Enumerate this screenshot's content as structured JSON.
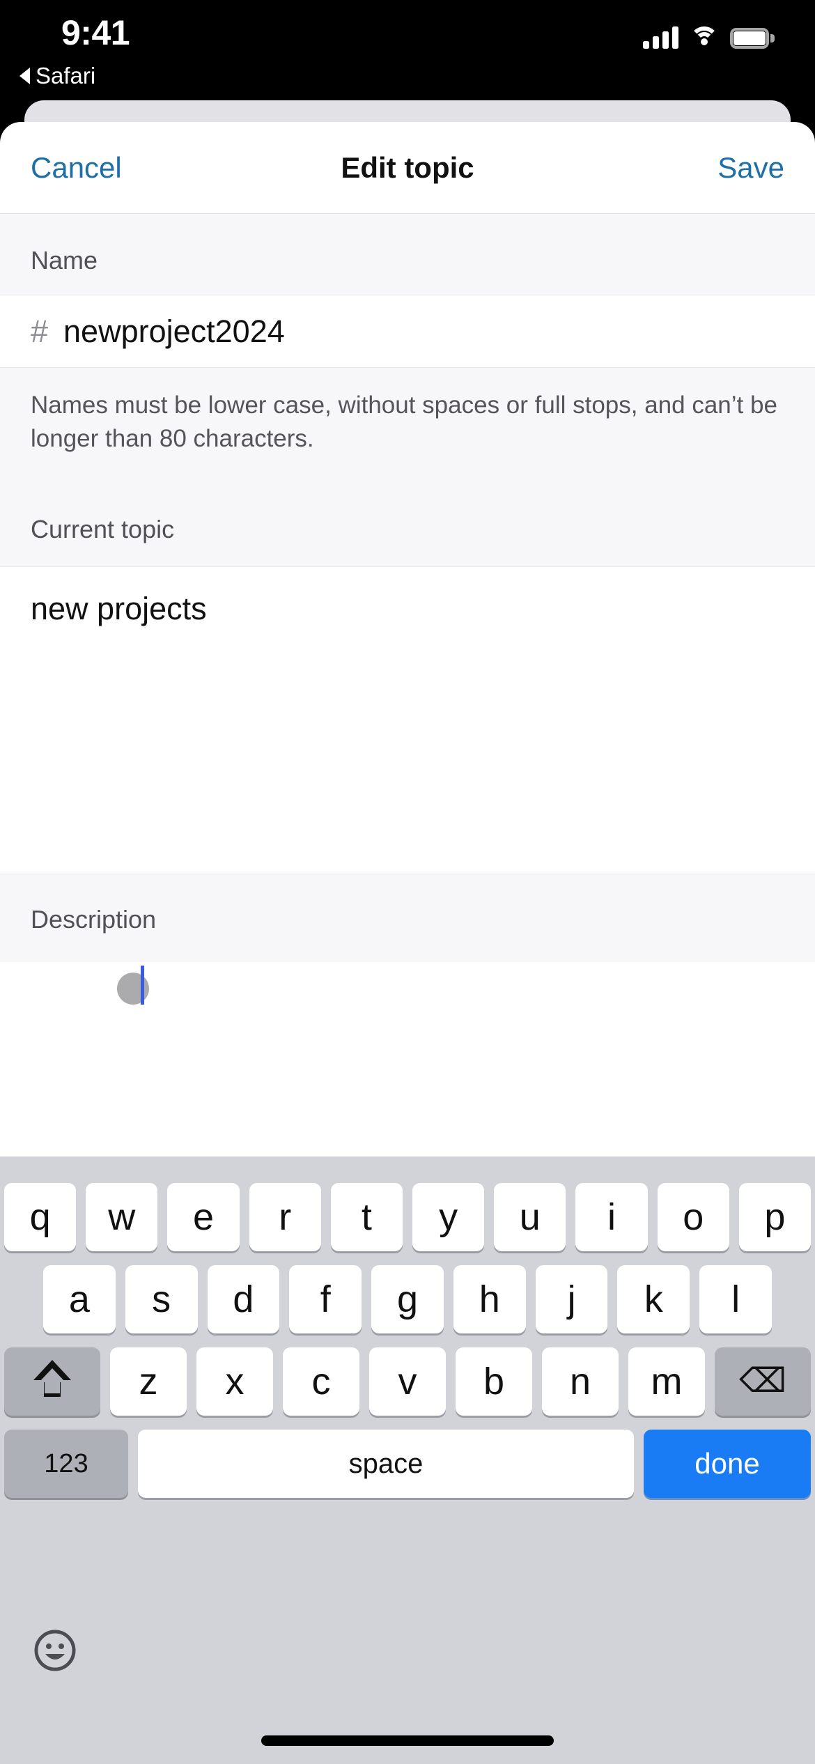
{
  "status_bar": {
    "time": "9:41",
    "back_app_label": "Safari",
    "icons": [
      "signal-bars-icon",
      "wifi-icon",
      "battery-icon"
    ]
  },
  "nav": {
    "cancel_label": "Cancel",
    "title": "Edit topic",
    "save_label": "Save",
    "accent_color": "#1d6fa5"
  },
  "form": {
    "name_section_label": "Name",
    "name_prefix": "#",
    "name_value": "newproject2024",
    "name_helper": "Names must be lower case, without spaces or full stops, and can’t be longer than 80 characters.",
    "topic_section_label": "Current topic",
    "topic_value": "new projects",
    "description_section_label": "Description"
  },
  "keyboard": {
    "row1": [
      "q",
      "w",
      "e",
      "r",
      "t",
      "y",
      "u",
      "i",
      "o",
      "p"
    ],
    "row2": [
      "a",
      "s",
      "d",
      "f",
      "g",
      "h",
      "j",
      "k",
      "l"
    ],
    "row3": [
      "z",
      "x",
      "c",
      "v",
      "b",
      "n",
      "m"
    ],
    "shift_key": "shift-icon",
    "delete_key": "⌫",
    "numbers_key": "123",
    "space_key": "space",
    "return_key": "done",
    "emoji_key": "emoji-icon",
    "return_key_color": "#1a7cf5",
    "background_color": "#d1d3d9"
  }
}
